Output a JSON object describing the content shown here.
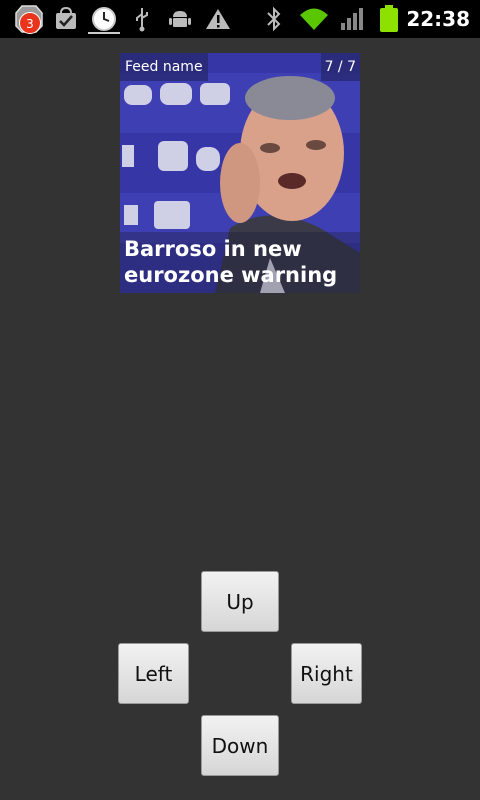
{
  "status_bar": {
    "notification_count": "3",
    "time": "22:38",
    "icons": [
      "notification-badge-icon",
      "task-check-icon",
      "clock-icon",
      "usb-icon",
      "android-debug-icon",
      "warning-icon",
      "bluetooth-icon",
      "wifi-icon",
      "signal-icon",
      "battery-icon"
    ],
    "colors": {
      "wifi": "#59c600",
      "battery": "#8ee000",
      "badge": "#e8341c"
    }
  },
  "widget": {
    "feed_name": "Feed name",
    "counter": "7 / 7",
    "headline": "Barroso in new eurozone warning"
  },
  "controls": {
    "up_label": "Up",
    "left_label": "Left",
    "right_label": "Right",
    "down_label": "Down"
  }
}
